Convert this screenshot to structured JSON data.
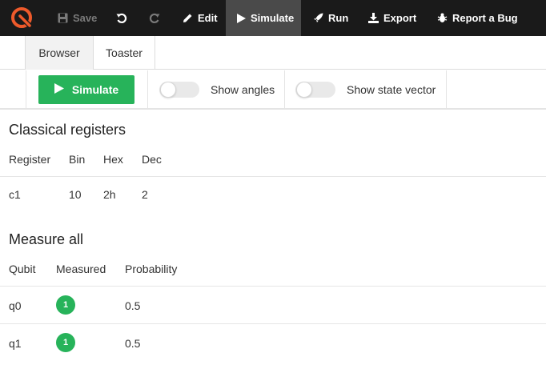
{
  "toolbar": {
    "save_label": "Save",
    "edit_label": "Edit",
    "simulate_label": "Simulate",
    "run_label": "Run",
    "export_label": "Export",
    "report_label": "Report a Bug"
  },
  "tabs": [
    {
      "label": "Browser",
      "active": true
    },
    {
      "label": "Toaster",
      "active": false
    }
  ],
  "controls": {
    "simulate_button_label": "Simulate",
    "show_angles_label": "Show angles",
    "show_angles_on": false,
    "show_state_vector_label": "Show state vector",
    "show_state_vector_on": false
  },
  "registers": {
    "title": "Classical registers",
    "headers": [
      "Register",
      "Bin",
      "Hex",
      "Dec"
    ],
    "rows": [
      {
        "register": "c1",
        "bin": "10",
        "hex": "2h",
        "dec": "2"
      }
    ]
  },
  "measure": {
    "title": "Measure all",
    "headers": [
      "Qubit",
      "Measured",
      "Probability"
    ],
    "rows": [
      {
        "qubit": "q0",
        "measured": "1",
        "probability": "0.5"
      },
      {
        "qubit": "q1",
        "measured": "1",
        "probability": "0.5"
      }
    ]
  },
  "colors": {
    "accent_green": "#27b35a",
    "toolbar_bg": "#1a1a1a",
    "logo_orange": "#ee5a2b"
  }
}
